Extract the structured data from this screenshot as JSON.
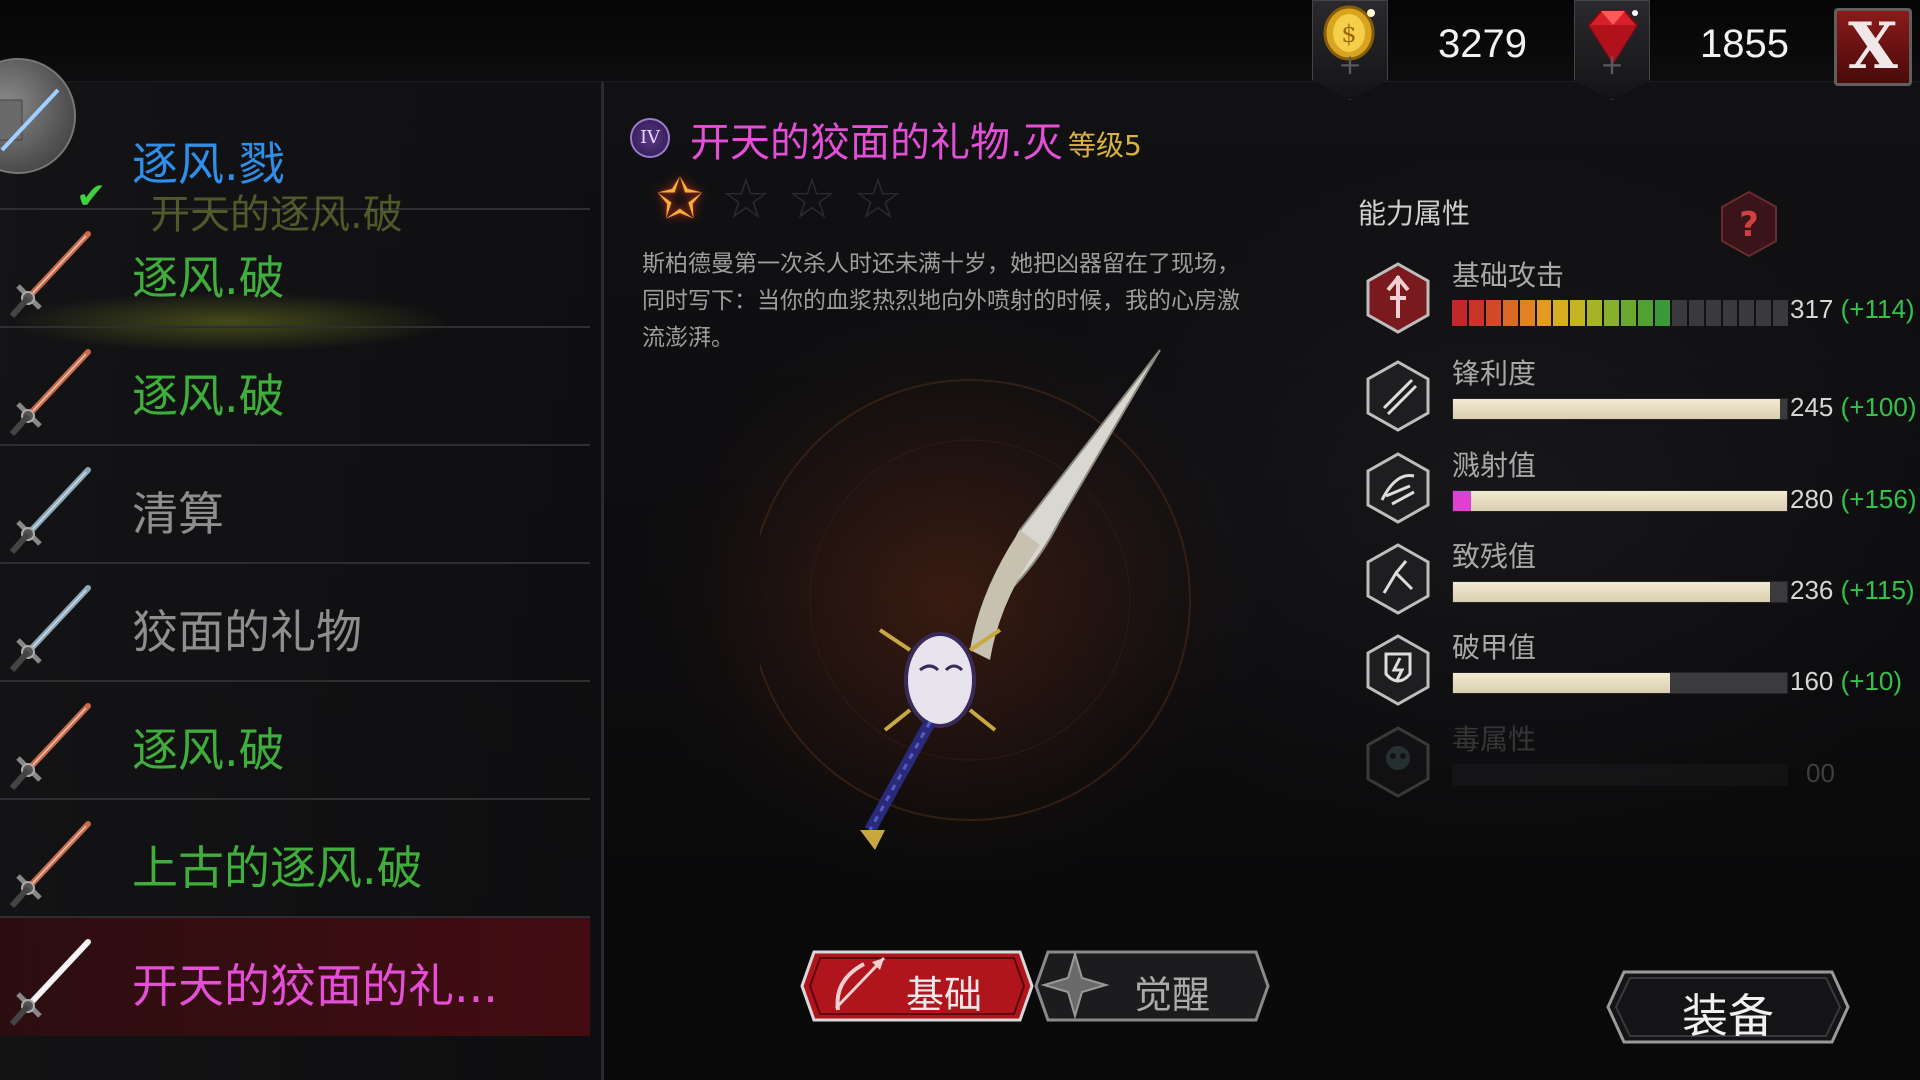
{
  "header": {
    "gold": {
      "icon": "gold-coin-icon",
      "value": "3279",
      "add_icon": "plus-icon"
    },
    "gems": {
      "icon": "ruby-gem-icon",
      "value": "1855",
      "add_icon": "plus-icon"
    },
    "close_label": "X"
  },
  "weapon_list": {
    "partial_header": "逐风.戮",
    "partial_ghost": "开天的逐风.破",
    "items": [
      {
        "label": "逐风.破",
        "color": "#3fae3a",
        "selected": false,
        "sword": "red"
      },
      {
        "label": "逐风.破",
        "color": "#3fae3a",
        "selected": false,
        "sword": "red"
      },
      {
        "label": "清算",
        "color": "#8e8e8e",
        "selected": false,
        "sword": "blue"
      },
      {
        "label": "狡面的礼物",
        "color": "#8e8e8e",
        "selected": false,
        "sword": "blue"
      },
      {
        "label": "逐风.破",
        "color": "#3fae3a",
        "selected": false,
        "sword": "red"
      },
      {
        "label": "上古的逐风.破",
        "color": "#3fae3a",
        "selected": false,
        "sword": "red"
      },
      {
        "label": "开天的狡面的礼...",
        "color": "#e44fd7",
        "selected": true,
        "sword": "white"
      }
    ],
    "header_color": "#2f8fe8"
  },
  "detail": {
    "rank": "IV",
    "name": "开天的狡面的礼物.灭",
    "level": "等级5",
    "stars_filled": 1,
    "stars_total": 4,
    "description": "斯柏德曼第一次杀人时还未满十岁，她把凶器留在了现场，同时写下：当你的血浆热烈地向外喷射的时候，我的心房激流澎湃。"
  },
  "tabs": {
    "basic": {
      "label": "基础",
      "active": true,
      "icon": "bow-arrow-icon"
    },
    "awaken": {
      "label": "觉醒",
      "active": false,
      "icon": "shuriken-icon"
    }
  },
  "stats": {
    "title": "能力属性",
    "help_label": "?",
    "items": [
      {
        "name": "基础攻击",
        "value": "317",
        "bonus": "(+114)",
        "fill": 0.65,
        "type": "segmented",
        "icon": "attack-icon"
      },
      {
        "name": "锋利度",
        "value": "245",
        "bonus": "(+100)",
        "fill": 0.98,
        "type": "plain",
        "icon": "sharpness-icon"
      },
      {
        "name": "溅射值",
        "value": "280",
        "bonus": "(+156)",
        "fill": 1.0,
        "type": "plain",
        "accent": "#e040d0",
        "icon": "splash-icon"
      },
      {
        "name": "致残值",
        "value": "236",
        "bonus": "(+115)",
        "fill": 0.95,
        "type": "plain",
        "icon": "cripple-icon"
      },
      {
        "name": "破甲值",
        "value": "160",
        "bonus": "(+10)",
        "fill": 0.65,
        "type": "plain",
        "icon": "armor-break-icon"
      },
      {
        "name": "毒属性",
        "value": "00",
        "bonus": "",
        "fill": 0,
        "type": "plain",
        "disabled": true,
        "icon": "poison-skull-icon"
      }
    ]
  },
  "equip_label": "装备"
}
